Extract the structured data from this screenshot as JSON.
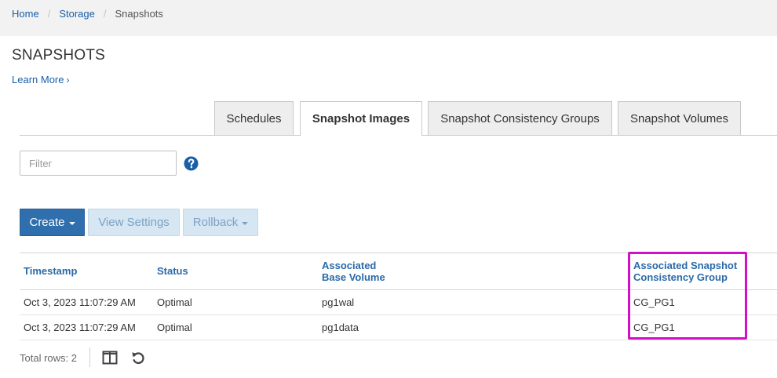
{
  "breadcrumb": {
    "home": "Home",
    "storage": "Storage",
    "current": "Snapshots",
    "separator": "/"
  },
  "page": {
    "title": "SNAPSHOTS",
    "learn_more": "Learn More",
    "learn_more_chevron": "›"
  },
  "tabs": [
    {
      "label": "Schedules",
      "active": false
    },
    {
      "label": "Snapshot Images",
      "active": true
    },
    {
      "label": "Snapshot Consistency Groups",
      "active": false
    },
    {
      "label": "Snapshot Volumes",
      "active": false
    }
  ],
  "filter": {
    "placeholder": "Filter",
    "help_icon": "question-circle-icon"
  },
  "toolbar": {
    "create": "Create",
    "view_settings": "View Settings",
    "rollback": "Rollback"
  },
  "table": {
    "columns": {
      "timestamp": "Timestamp",
      "status": "Status",
      "base_volume_line1": "Associated",
      "base_volume_line2": "Base Volume",
      "cg_line1": "Associated Snapshot",
      "cg_line2": "Consistency Group"
    },
    "rows": [
      {
        "timestamp": "Oct 3, 2023 11:07:29 AM",
        "status": "Optimal",
        "base_volume": "pg1wal",
        "consistency_group": "CG_PG1"
      },
      {
        "timestamp": "Oct 3, 2023 11:07:29 AM",
        "status": "Optimal",
        "base_volume": "pg1data",
        "consistency_group": "CG_PG1"
      }
    ]
  },
  "footer": {
    "total_rows": "Total rows: 2",
    "columns_icon": "columns-icon",
    "refresh_icon": "refresh-icon"
  },
  "colors": {
    "link": "#1a5fa8",
    "primary_button": "#2f6fad",
    "highlight": "#d40fcc"
  }
}
